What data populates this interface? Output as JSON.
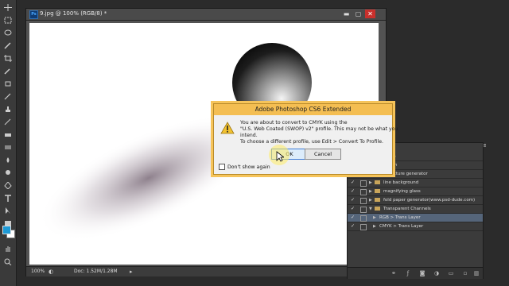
{
  "document": {
    "title": "9.jpg @ 100% (RGB/8) *",
    "ps_badge": "Ps",
    "zoom": "100%",
    "doc_info": "Doc: 1.52M/1.28M"
  },
  "window_controls": {
    "minimize": "▬",
    "restore": "▢",
    "close": "✕"
  },
  "dialog": {
    "title": "Adobe Photoshop CS6 Extended",
    "message_lines": [
      "You are about to convert to CMYK using the",
      "\"U.S. Web Coated (SWOP) v2\" profile. This may not be what you",
      "intend.",
      "To choose a different profile, use Edit > Convert To Profile."
    ],
    "ok_label": "OK",
    "cancel_label": "Cancel",
    "dont_show_label": "Don't show again"
  },
  "layers_panel": {
    "rows": [
      {
        "label": "tch",
        "visible": false,
        "indent": 0,
        "folder": false
      },
      {
        "label": "iath",
        "visible": false,
        "indent": 0,
        "folder": false
      },
      {
        "label": "texture generator",
        "visible": false,
        "indent": 0,
        "folder": false
      },
      {
        "label": "line background",
        "visible": true,
        "indent": 0,
        "folder": true
      },
      {
        "label": "magnifying glass",
        "visible": true,
        "indent": 0,
        "folder": true
      },
      {
        "label": "fold paper generator(www.psd-dude.com)",
        "visible": true,
        "indent": 0,
        "folder": true
      },
      {
        "label": "Transparent Channels",
        "visible": true,
        "indent": 0,
        "folder": true
      },
      {
        "label": "RGB > Trans Layer",
        "visible": true,
        "indent": 1,
        "folder": false,
        "selected": true
      },
      {
        "label": "CMYK > Trans Layer",
        "visible": true,
        "indent": 1,
        "folder": false
      }
    ]
  },
  "colors": {
    "foreground": "#1e9ad6",
    "background": "#ffffff",
    "dialog_accent": "#f4be52"
  }
}
